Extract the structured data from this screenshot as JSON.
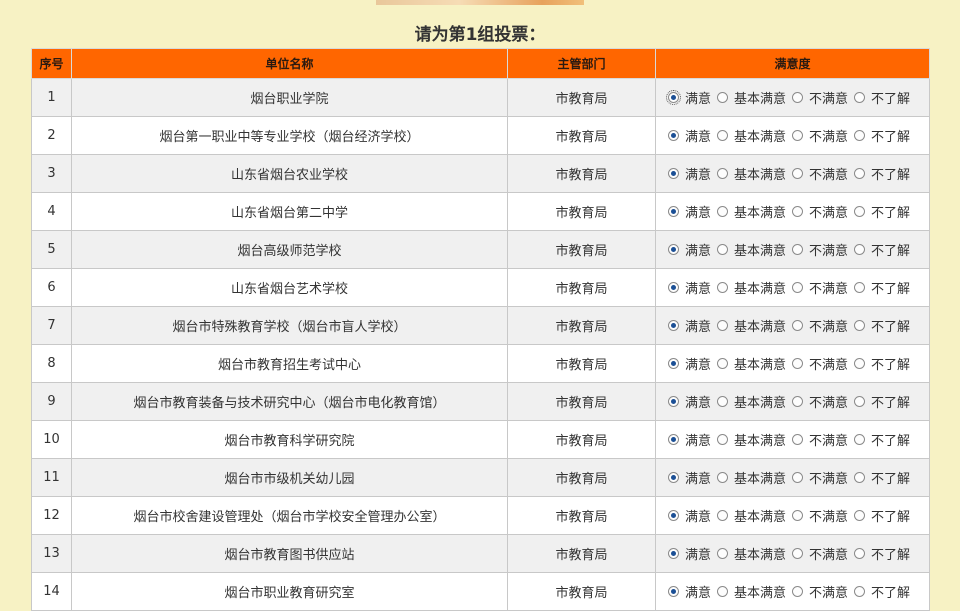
{
  "heading": "请为第1组投票：",
  "colors": {
    "header_bg": "#ff6600",
    "page_bg": "#f7f2c4",
    "radio_checked": "#1b4f95"
  },
  "table": {
    "headers": [
      "序号",
      "单位名称",
      "主管部门",
      "满意度"
    ],
    "options": [
      "满意",
      "基本满意",
      "不满意",
      "不了解"
    ],
    "rows": [
      {
        "no": "1",
        "name": "烟台职业学院",
        "dept": "市教育局"
      },
      {
        "no": "2",
        "name": "烟台第一职业中等专业学校（烟台经济学校）",
        "dept": "市教育局"
      },
      {
        "no": "3",
        "name": "山东省烟台农业学校",
        "dept": "市教育局"
      },
      {
        "no": "4",
        "name": "山东省烟台第二中学",
        "dept": "市教育局"
      },
      {
        "no": "5",
        "name": "烟台高级师范学校",
        "dept": "市教育局"
      },
      {
        "no": "6",
        "name": "山东省烟台艺术学校",
        "dept": "市教育局"
      },
      {
        "no": "7",
        "name": "烟台市特殊教育学校（烟台市盲人学校）",
        "dept": "市教育局"
      },
      {
        "no": "8",
        "name": "烟台市教育招生考试中心",
        "dept": "市教育局"
      },
      {
        "no": "9",
        "name": "烟台市教育装备与技术研究中心（烟台市电化教育馆）",
        "dept": "市教育局"
      },
      {
        "no": "10",
        "name": "烟台市教育科学研究院",
        "dept": "市教育局"
      },
      {
        "no": "11",
        "name": "烟台市市级机关幼儿园",
        "dept": "市教育局"
      },
      {
        "no": "12",
        "name": "烟台市校舍建设管理处（烟台市学校安全管理办公室）",
        "dept": "市教育局"
      },
      {
        "no": "13",
        "name": "烟台市教育图书供应站",
        "dept": "市教育局"
      },
      {
        "no": "14",
        "name": "烟台市职业教育研究室",
        "dept": "市教育局"
      }
    ]
  }
}
